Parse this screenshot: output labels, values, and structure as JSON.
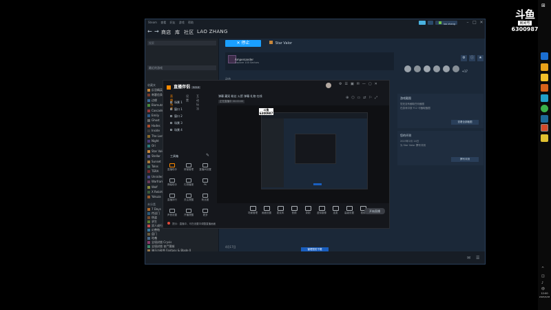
{
  "steam": {
    "menu": [
      "Steam",
      "查看",
      "好友",
      "游戏",
      "帮助"
    ],
    "nav": {
      "store": "商店",
      "library": "库",
      "community": "社区",
      "user": "LAO ZHANG"
    },
    "account": "lao zhang",
    "library_search": "搜索",
    "library_filter": "最近的游戏",
    "library_sections": {
      "favorites": "收藏夹",
      "uncategorized": "未分类"
    },
    "library_items": [
      "反恐精英",
      "刺客信条大合",
      "边缘",
      "Biomutant",
      "Cascade",
      "Emily",
      "Ghost",
      "Hades",
      "Inside",
      "The Last",
      "Night",
      "Ori",
      "Star Valor",
      "Stellar",
      "Sunset",
      "Talos",
      "TERA",
      "Unrailed",
      "Warframe",
      "Wolf",
      "X Rebirth",
      "Yakuza",
      "7 Days",
      "传送门",
      "侠盗",
      "求生",
      "双人成行",
      "幻兽帕",
      "盘门",
      "咕噜",
      "全境封锁 Crysis",
      "全境封锁 丧尸围城",
      "骑马与砍杀 Fantasy & Blade II",
      "骑士"
    ],
    "add_game": "添加游戏",
    "stop_button": "停止",
    "current_game": "Star Valor",
    "achievement_name": "Ampersander",
    "achievement_desc": "Explore 100 Sectors",
    "achievement_extra": "+17",
    "side_section1_title": "游戏截图",
    "side_section1_text": "您还没有截取任何截图",
    "side_section1_text2": "在游戏中按 F12 可截取截图",
    "side_section1_button": "查看全部截图",
    "side_section2_title": "您的评测",
    "side_section2_date": "2023年2月 14日",
    "side_section2_text": "为 Star Valor 撰写评测",
    "side_section2_button": "撰写评测",
    "activity_label": "动态",
    "activity_date": "4月17日",
    "download_button": "管理您的下载",
    "download_sub": "下载"
  },
  "overlay": {
    "app_name": "直播伴侣",
    "app_badge": "9.5.0",
    "tabs": [
      "直播场景",
      "设置",
      "互动玩法"
    ],
    "scenes": [
      "场景 1",
      "窗口 1",
      "窗口 2",
      "场景 3",
      "场景 4"
    ],
    "tools_title": "工具箱",
    "tools": [
      "直播助手",
      "房管管理",
      "直播间设置",
      "弹幕助手",
      "礼物播报",
      "PK",
      "直播排行",
      "关注提醒",
      "粉丝团",
      "声音设置",
      "开播提醒",
      "更多"
    ],
    "header_info": "弹幕 藏双 粉丝 火箭 弹幕 礼物 在线",
    "header_sub": "正在直播中 00:00:00",
    "controls": [
      "场景管理",
      "画面设置",
      "麦克风",
      "音频",
      "录制",
      "虚拟摄像",
      "连麦",
      "高级设置",
      "视频"
    ],
    "start_button": "开始直播",
    "notice": "提示：直播中，可在设置中调整直播画面"
  },
  "douyu": {
    "logo": "斗鱼",
    "room_label": "房间号",
    "room_id": "6300987"
  },
  "taskbar": {
    "time": "12:00",
    "date": "2023/4/18",
    "lang": "中"
  },
  "colors": {
    "steam_bg": "#1b2838",
    "steam_accent": "#1a9fff",
    "overlay_bg": "#15171c"
  }
}
